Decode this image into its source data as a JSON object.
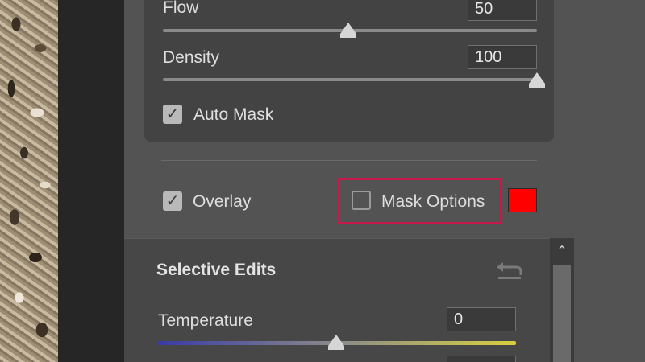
{
  "brush_settings": {
    "flow": {
      "label": "Flow",
      "value": "50",
      "slider_fraction": 0.5
    },
    "density": {
      "label": "Density",
      "value": "100",
      "slider_fraction": 1.0
    },
    "auto_mask": {
      "label": "Auto Mask",
      "checked": true
    }
  },
  "overlay": {
    "label": "Overlay",
    "checked": true
  },
  "mask_options": {
    "label": "Mask Options",
    "checked": false,
    "color": "#ff0000"
  },
  "selective_edits": {
    "title": "Selective Edits",
    "temperature": {
      "label": "Temperature",
      "value": "0",
      "slider_fraction": 0.5
    }
  },
  "icons": {
    "check": "✓",
    "scroll_up": "chevron-up-icon",
    "reset": "reset-icon"
  },
  "colors": {
    "highlight": "#c8174a",
    "panel": "#535353",
    "subpanel": "#434343"
  }
}
